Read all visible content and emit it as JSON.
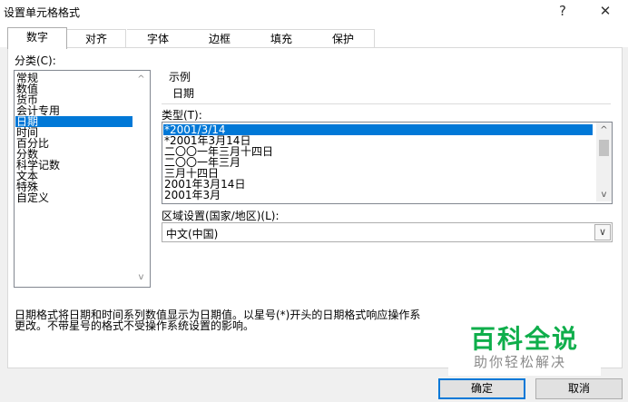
{
  "window": {
    "title": "设置单元格格式",
    "help_label": "?",
    "close_label": "✕"
  },
  "tabs": [
    {
      "label": "数字",
      "active": true
    },
    {
      "label": "对齐"
    },
    {
      "label": "字体"
    },
    {
      "label": "边框"
    },
    {
      "label": "填充"
    },
    {
      "label": "保护"
    }
  ],
  "category": {
    "label": "分类(C):",
    "items": [
      "常规",
      "数值",
      "货币",
      "会计专用",
      "日期",
      "时间",
      "百分比",
      "分数",
      "科学记数",
      "文本",
      "特殊",
      "自定义"
    ],
    "selected": "日期"
  },
  "sample": {
    "label": "示例",
    "value": "日期"
  },
  "type": {
    "label": "类型(T):",
    "items": [
      "*2001/3/14",
      "*2001年3月14日",
      "二〇〇一年三月十四日",
      "二〇〇一年三月",
      "三月十四日",
      "2001年3月14日",
      "2001年3月"
    ],
    "selected": "*2001/3/14"
  },
  "locale": {
    "label": "区域设置(国家/地区)(L):",
    "value": "中文(中国)"
  },
  "description": {
    "line1": "日期格式将日期和时间系列数值显示为日期值。以星号(*)开头的日期格式响应操作系",
    "line2": "更改。不带星号的格式不受操作系统设置的影响。"
  },
  "buttons": {
    "ok": "确定",
    "cancel": "取消"
  },
  "watermark": {
    "title": "百科全说",
    "subtitle": "助你轻松解决"
  },
  "icons": {
    "scroll_up": "▲",
    "scroll_down": "▼",
    "chevron_up": "^",
    "chevron_down": "v",
    "combo_down": "∨"
  }
}
